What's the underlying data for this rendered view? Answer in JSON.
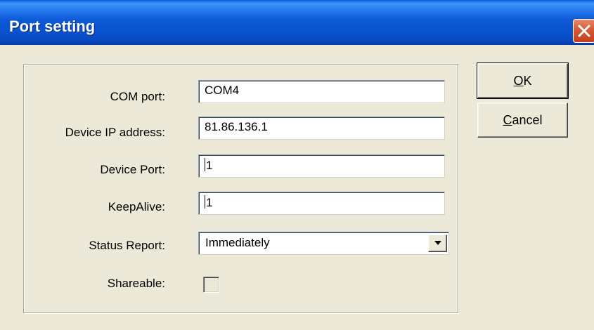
{
  "window": {
    "title": "Port setting"
  },
  "form": {
    "com_port": {
      "label": "COM port:",
      "value": "COM4"
    },
    "device_ip": {
      "label": "Device IP address:",
      "value": "81.86.136.1"
    },
    "device_port": {
      "label": "Device Port:",
      "value": "1"
    },
    "keepalive": {
      "label": "KeepAlive:",
      "value": "1"
    },
    "status_report": {
      "label": "Status Report:",
      "value": "Immediately"
    },
    "shareable": {
      "label": "Shareable:",
      "checked": false,
      "enabled": false
    }
  },
  "buttons": {
    "ok": {
      "accel": "O",
      "rest": "K"
    },
    "cancel": {
      "accel": "C",
      "rest": "ancel"
    }
  },
  "icons": {
    "close": "close-icon",
    "dropdown": "chevron-down-icon"
  },
  "colors": {
    "titlebar": "#0a53cf",
    "close_button": "#d65a37",
    "dialog_bg": "#ece9d8"
  }
}
